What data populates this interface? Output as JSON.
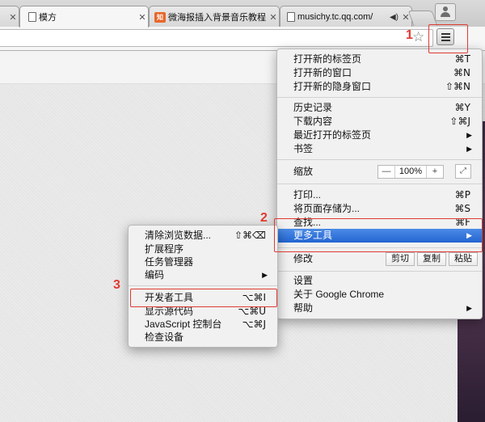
{
  "tabs": [
    {
      "title": "",
      "close": "✕"
    },
    {
      "title": "模方",
      "close": "✕"
    },
    {
      "title": "微海报插入背景音乐教程",
      "favicon_text": "知",
      "close": "✕"
    },
    {
      "title": "musichy.tc.qq.com/",
      "close": "✕"
    }
  ],
  "chrome_menu": {
    "items_group1": [
      {
        "label": "打开新的标签页",
        "shortcut": "⌘T"
      },
      {
        "label": "打开新的窗口",
        "shortcut": "⌘N"
      },
      {
        "label": "打开新的隐身窗口",
        "shortcut": "⇧⌘N"
      }
    ],
    "items_group2": [
      {
        "label": "历史记录",
        "shortcut": "⌘Y"
      },
      {
        "label": "下载内容",
        "shortcut": "⇧⌘J"
      },
      {
        "label": "最近打开的标签页",
        "arrow": "▶"
      },
      {
        "label": "书签",
        "arrow": "▶"
      }
    ],
    "zoom": {
      "label": "缩放",
      "minus": "—",
      "value": "100%",
      "plus": "+",
      "fullscreen": "⤢"
    },
    "items_group4": [
      {
        "label": "打印...",
        "shortcut": "⌘P"
      },
      {
        "label": "将页面存储为...",
        "shortcut": "⌘S"
      },
      {
        "label": "查找...",
        "shortcut": "⌘F"
      },
      {
        "label": "更多工具",
        "arrow": "▶"
      }
    ],
    "edit": {
      "label": "修改",
      "cut": "剪切",
      "copy": "复制",
      "paste": "粘贴"
    },
    "items_group6": [
      {
        "label": "设置"
      },
      {
        "label": "关于 Google Chrome"
      },
      {
        "label": "帮助",
        "arrow": "▶"
      }
    ]
  },
  "more_tools_menu": {
    "items": [
      {
        "label": "清除浏览数据...",
        "shortcut": "⇧⌘⌫"
      },
      {
        "label": "扩展程序"
      },
      {
        "label": "任务管理器"
      },
      {
        "label": "编码",
        "arrow": "▶"
      },
      {
        "label": "开发者工具",
        "shortcut": "⌥⌘I"
      },
      {
        "label": "显示源代码",
        "shortcut": "⌥⌘U"
      },
      {
        "label": "JavaScript 控制台",
        "shortcut": "⌥⌘J"
      },
      {
        "label": "检查设备"
      }
    ]
  },
  "annotations": {
    "n1": "1",
    "n2": "2",
    "n3": "3"
  },
  "colors": {
    "annotation_red": "#e03a32",
    "highlight_blue": "#2f6fda"
  }
}
